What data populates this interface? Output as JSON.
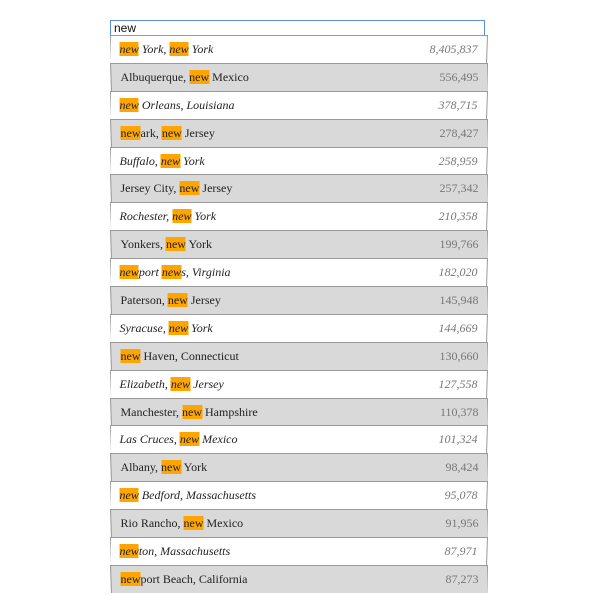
{
  "search": {
    "value": "new",
    "highlight_color": "#ffa500"
  },
  "results": [
    {
      "name": "new York, new York",
      "population": "8,405,837"
    },
    {
      "name": "Albuquerque, new Mexico",
      "population": "556,495"
    },
    {
      "name": "new Orleans, Louisiana",
      "population": "378,715"
    },
    {
      "name": "newark, new Jersey",
      "population": "278,427"
    },
    {
      "name": "Buffalo, new York",
      "population": "258,959"
    },
    {
      "name": "Jersey City, new Jersey",
      "population": "257,342"
    },
    {
      "name": "Rochester, new York",
      "population": "210,358"
    },
    {
      "name": "Yonkers, new York",
      "population": "199,766"
    },
    {
      "name": "newport news, Virginia",
      "population": "182,020"
    },
    {
      "name": "Paterson, new Jersey",
      "population": "145,948"
    },
    {
      "name": "Syracuse, new York",
      "population": "144,669"
    },
    {
      "name": "new Haven, Connecticut",
      "population": "130,660"
    },
    {
      "name": "Elizabeth, new Jersey",
      "population": "127,558"
    },
    {
      "name": "Manchester, new Hampshire",
      "population": "110,378"
    },
    {
      "name": "Las Cruces, new Mexico",
      "population": "101,324"
    },
    {
      "name": "Albany, new York",
      "population": "98,424"
    },
    {
      "name": "new Bedford, Massachusetts",
      "population": "95,078"
    },
    {
      "name": "Rio Rancho, new Mexico",
      "population": "91,956"
    },
    {
      "name": "newton, Massachusetts",
      "population": "87,971"
    },
    {
      "name": "newport Beach, California",
      "population": "87,273"
    }
  ]
}
